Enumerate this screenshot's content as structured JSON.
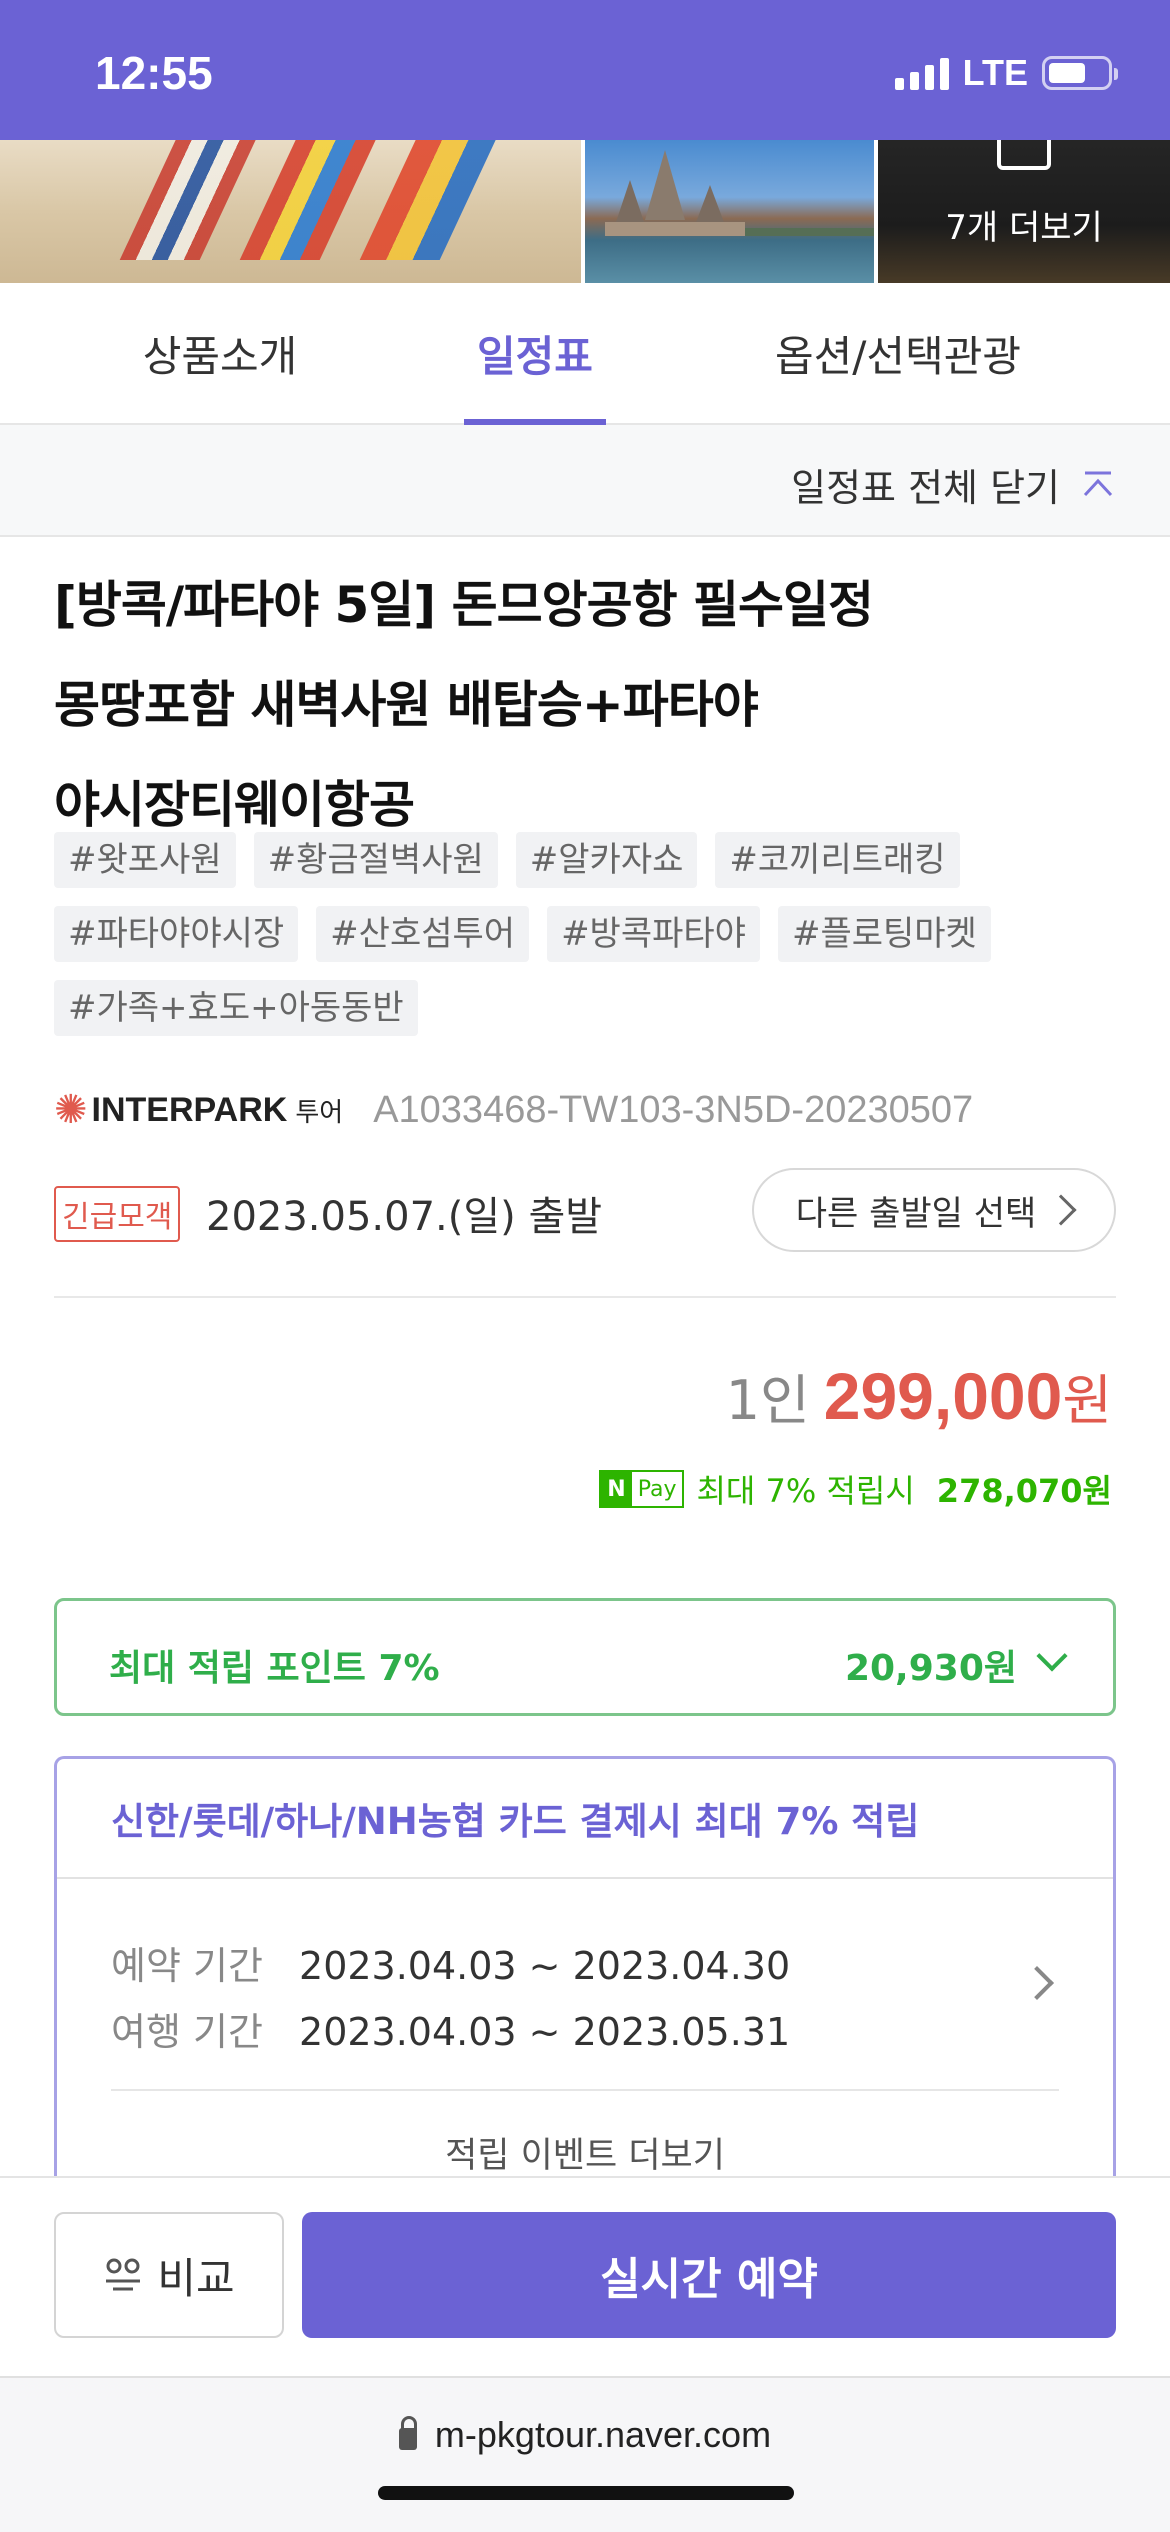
{
  "status_bar": {
    "time": "12:55",
    "network": "LTE"
  },
  "gallery": {
    "more_label": "7개 더보기"
  },
  "tabs": [
    {
      "label": "상품소개"
    },
    {
      "label": "일정표"
    },
    {
      "label": "옵션/선택관광"
    }
  ],
  "itinerary": {
    "close_all_label": "일정표 전체 닫기"
  },
  "product": {
    "title_lines": [
      "[방콕/파타야 5일] 돈므앙공항 필수일정",
      "몽땅포함 새벽사원 배탑승+파타야",
      "야시장티웨이항공"
    ],
    "tags": [
      "#왓포사원",
      "#황금절벽사원",
      "#알카자쇼",
      "#코끼리트래킹",
      "#파타야야시장",
      "#산호섬투어",
      "#방콕파타야",
      "#플로팅마켓",
      "#가족+효도+아동동반"
    ],
    "company_logo": {
      "text": "INTERPARK",
      "suffix": "투어"
    },
    "product_code": "A1033468-TW103-3N5D-20230507",
    "urgent_badge": "긴급모객",
    "departure": "2023.05.07.(일) 출발",
    "other_date_button": "다른 출발일 선택"
  },
  "price": {
    "per_person": "1인",
    "amount": "299,000",
    "currency": "원",
    "npay_badge_n": "N",
    "npay_badge_pay": "Pay",
    "npay_text": "최대 7% 적립시",
    "npay_value": "278,070원"
  },
  "points": {
    "label": "최대 적립 포인트 7%",
    "value": "20,930원"
  },
  "card_promo": {
    "headline": "신한/롯데/하나/NH농협 카드 결제시 최대 7% 적립",
    "booking_label": "예약 기간",
    "booking_period": "2023.04.03 ~ 2023.04.30",
    "travel_label": "여행 기간",
    "travel_period": "2023.04.03 ~ 2023.05.31",
    "more_label": "적립 이벤트 더보기"
  },
  "actions": {
    "compare_label": "비교",
    "reserve_label": "실시간 예약"
  },
  "browser": {
    "url": "m-pkgtour.naver.com"
  },
  "colors": {
    "brand": "#6b62d4",
    "price": "#e05a4e",
    "points": "#2fae4a",
    "npay": "#2db400"
  }
}
